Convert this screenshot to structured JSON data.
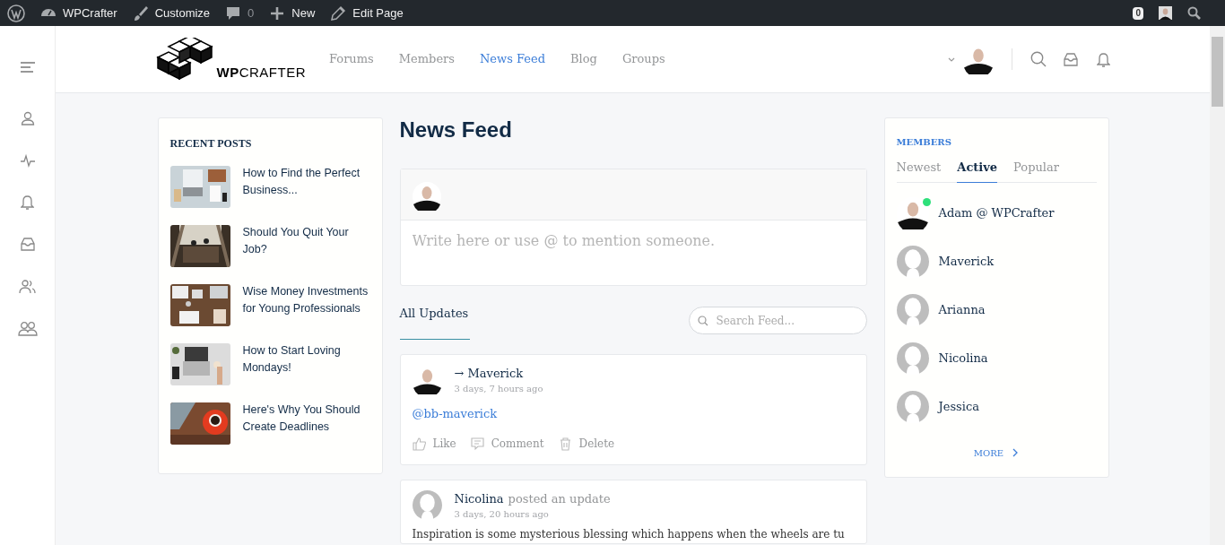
{
  "admin_bar": {
    "items": [
      {
        "kind": "wordpress"
      },
      {
        "kind": "site",
        "label": "WPCrafter"
      },
      {
        "kind": "customize",
        "label": "Customize"
      },
      {
        "kind": "comments",
        "label": "0"
      },
      {
        "kind": "new",
        "label": "New"
      },
      {
        "kind": "edit",
        "label": "Edit Page"
      }
    ],
    "notification_count": "0"
  },
  "sidebar": {
    "items": [
      {
        "kind": "menu"
      },
      {
        "kind": "profile"
      },
      {
        "kind": "activity"
      },
      {
        "kind": "notifications"
      },
      {
        "kind": "messages"
      },
      {
        "kind": "connections"
      },
      {
        "kind": "groups"
      }
    ]
  },
  "header": {
    "logo": "**WP**CRAFTER",
    "nav": [
      {
        "label": "Forums",
        "selected": false
      },
      {
        "label": "Members",
        "selected": false
      },
      {
        "label": "News Feed",
        "selected": true
      },
      {
        "label": "Blog",
        "selected": false
      },
      {
        "label": "Groups",
        "selected": false
      }
    ]
  },
  "recent_posts": {
    "title": "RECENT POSTS",
    "posts": [
      {
        "title": "How to Find the Perfect Business..."
      },
      {
        "title": "Should You Quit Your Job?"
      },
      {
        "title": "Wise Money Investments for Young Professionals"
      },
      {
        "title": "How to Start Loving Mondays!"
      },
      {
        "title": "Here's Why You Should Create Deadlines"
      }
    ]
  },
  "feed": {
    "title": "News Feed",
    "composer": {
      "placeholder": "Write here or use @ to mention someone."
    },
    "tabs": [
      {
        "label": "All Updates",
        "selected": true
      }
    ],
    "search": {
      "placeholder": "Search Feed..."
    },
    "activities": [
      {
        "kind": "mention",
        "author": "→ Maverick",
        "time": "3 days, 7 hours ago",
        "content": "@bb-maverick",
        "actions": [
          "Like",
          "Comment",
          "Delete"
        ]
      },
      {
        "kind": "update",
        "avatar": {
          "kind": "default"
        },
        "author": "Nicolina",
        "action": "posted an update",
        "time": "3 days, 20 hours ago",
        "content": "Inspiration is some mysterious blessing which happens when the wheels are tu"
      }
    ]
  },
  "members": {
    "title": "MEMBERS",
    "tabs": [
      {
        "label": "Newest",
        "selected": false
      },
      {
        "label": "Active",
        "selected": true
      },
      {
        "label": "Popular",
        "selected": false
      }
    ],
    "list": [
      {
        "name": "Adam @ WPCrafter",
        "online": true,
        "color": "#2ee07a"
      },
      {
        "name": "Maverick",
        "avatar": {
          "kind": "default"
        },
        "online": false
      },
      {
        "name": "Arianna",
        "avatar": {
          "kind": "default"
        },
        "online": false
      },
      {
        "name": "Nicolina",
        "avatar": {
          "kind": "default"
        },
        "online": false
      },
      {
        "name": "Jessica",
        "avatar": {
          "kind": "default"
        },
        "online": false
      }
    ],
    "more": "MORE"
  }
}
